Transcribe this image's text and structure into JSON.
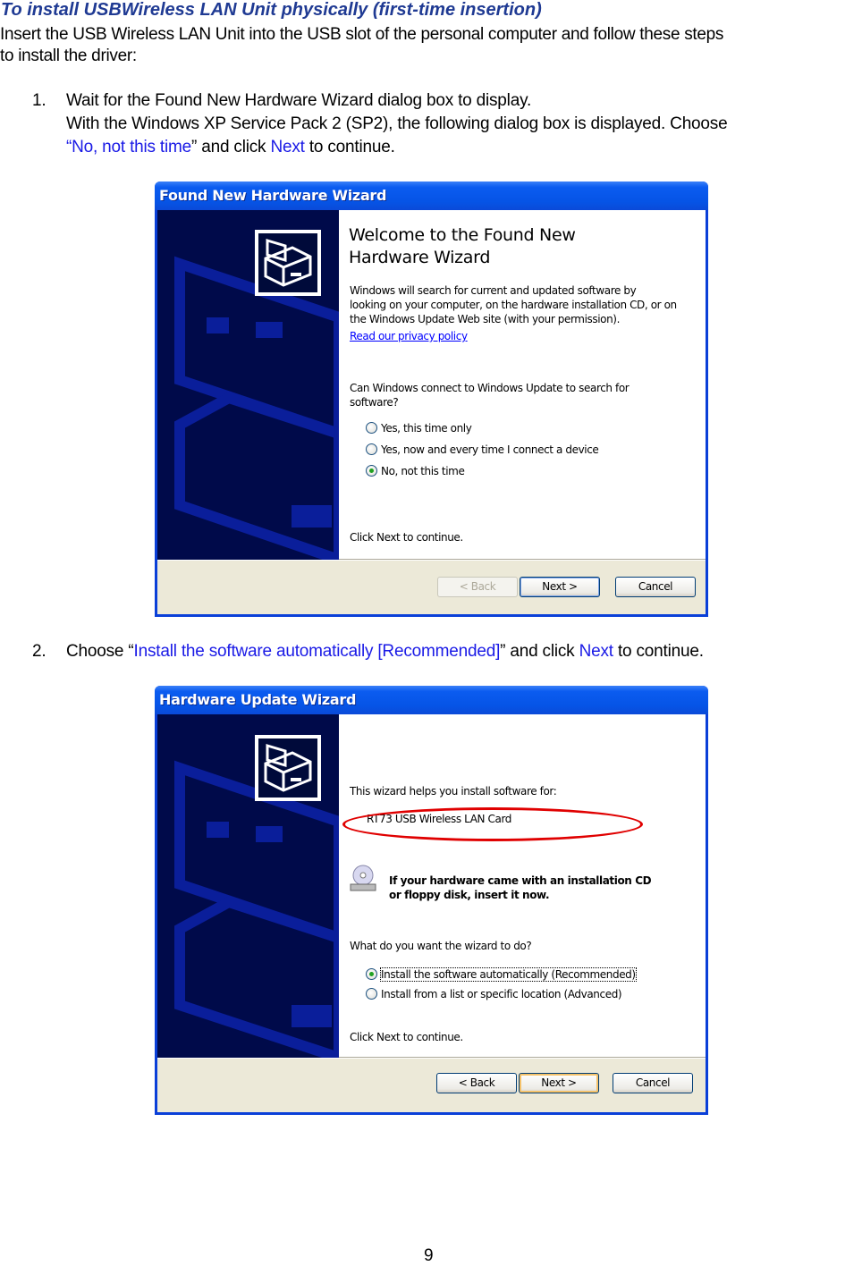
{
  "document": {
    "heading": "To install USBWireless LAN Unit physically (first-time insertion)",
    "intro_line1": "Insert the USB Wireless LAN Unit into the USB slot of the personal computer and follow these steps",
    "intro_line2": "to install the driver:",
    "page_number": "9",
    "link_color": "#1a1ae6",
    "heading_color": "#1f3a93"
  },
  "steps": [
    {
      "number": "1.",
      "line1": "Wait for the Found New Hardware Wizard dialog box to display.",
      "line2": "With the Windows XP Service Pack 2 (SP2), the following dialog box is displayed.  Choose",
      "line3_open_quote": "“",
      "line3_option": "No, not this time",
      "line3_mid": "” and click ",
      "line3_button": "Next",
      "line3_end": " to continue."
    },
    {
      "number": "2.",
      "pre": "Choose “",
      "option": "Install the software automatically [Recommended]",
      "mid": "” and click ",
      "button": "Next",
      "end": " to continue."
    }
  ],
  "dialog1": {
    "title": "Found New Hardware Wizard",
    "welcome_line1": "Welcome to the Found New",
    "welcome_line2": "Hardware Wizard",
    "desc_line1": "Windows will search for current and updated software by",
    "desc_line2": "looking on your computer, on the hardware installation CD, or on",
    "desc_line3": "the Windows Update Web site (with your permission).",
    "privacy_link": "Read our privacy policy",
    "question_line1": "Can Windows connect to Windows Update to search for",
    "question_line2": "software?",
    "options": [
      {
        "label": "Yes, this time only",
        "checked": false
      },
      {
        "label": "Yes, now and every time I connect a device",
        "checked": false
      },
      {
        "label": "No, not this time",
        "checked": true
      }
    ],
    "footer_text": "Click Next to continue.",
    "buttons": {
      "back": "< Back",
      "next": "Next >",
      "cancel": "Cancel"
    },
    "back_enabled": false
  },
  "dialog2": {
    "title": "Hardware Update Wizard",
    "helps_text": "This wizard helps you install software for:",
    "device_name": "RT73 USB Wireless LAN Card",
    "cd_line1": "If your hardware came with an installation CD",
    "cd_line2": "or floppy disk, insert it now.",
    "question": "What do you want the wizard to do?",
    "options": [
      {
        "label": "Install the software automatically (Recommended)",
        "checked": true
      },
      {
        "label": "Install from a list or specific location (Advanced)",
        "checked": false
      }
    ],
    "footer_text": "Click Next to continue.",
    "buttons": {
      "back": "< Back",
      "next": "Next >",
      "cancel": "Cancel"
    },
    "highlight_color": "#e00000"
  }
}
